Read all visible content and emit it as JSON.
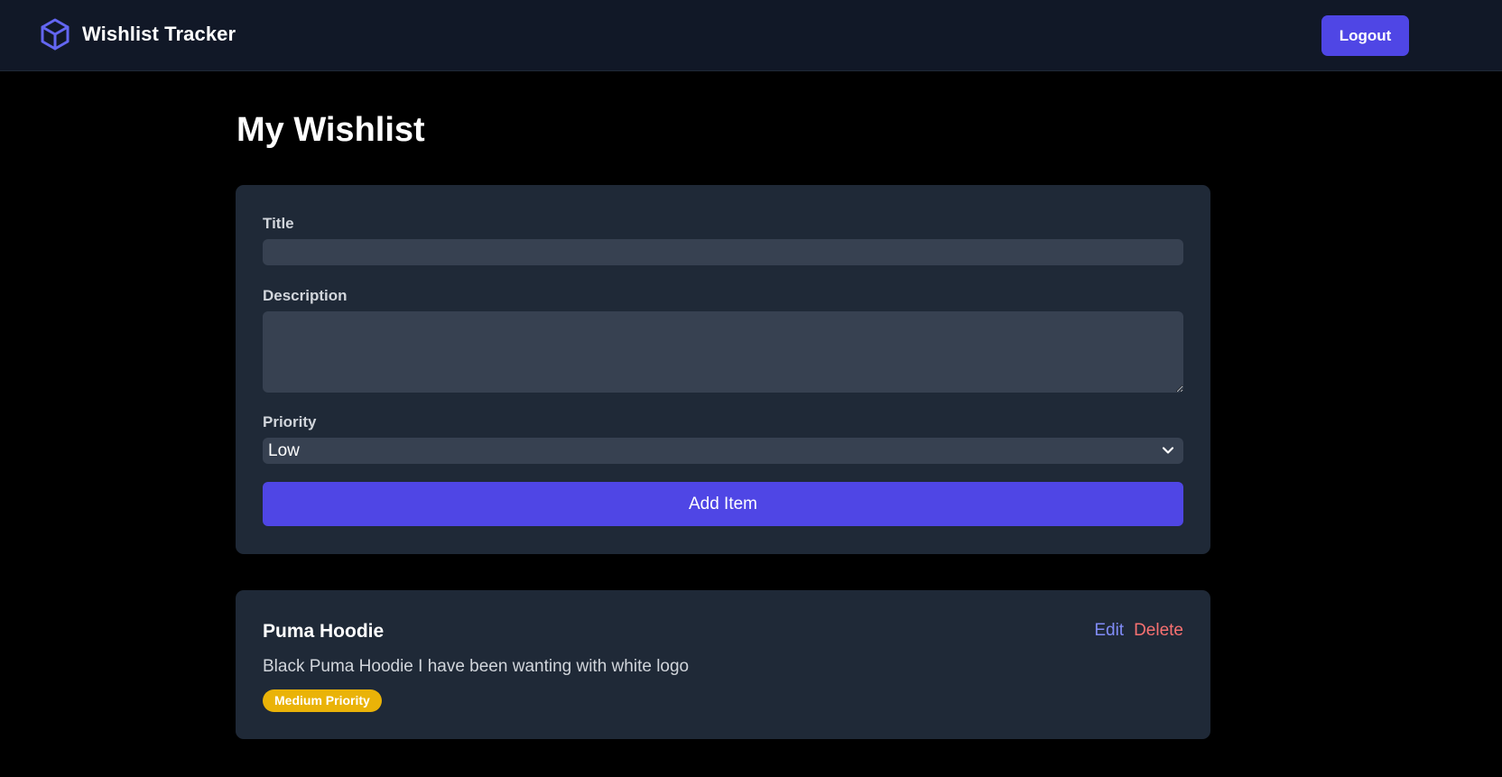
{
  "header": {
    "app_title": "Wishlist Tracker",
    "logo_icon": "cube-icon",
    "logout_label": "Logout"
  },
  "page": {
    "title": "My Wishlist"
  },
  "form": {
    "title_label": "Title",
    "title_value": "",
    "description_label": "Description",
    "description_value": "",
    "priority_label": "Priority",
    "priority_selected": "Low",
    "add_button_label": "Add Item"
  },
  "items": [
    {
      "title": "Puma Hoodie",
      "description": "Black Puma Hoodie I have been wanting with white logo",
      "priority_badge": "Medium Priority",
      "edit_label": "Edit",
      "delete_label": "Delete"
    }
  ],
  "colors": {
    "accent": "#4f46e5",
    "nav_background": "#111827",
    "card_background": "#1f2937",
    "input_background": "#374151",
    "medium_priority": "#eab308",
    "edit": "#818cf8",
    "delete": "#f87171"
  }
}
